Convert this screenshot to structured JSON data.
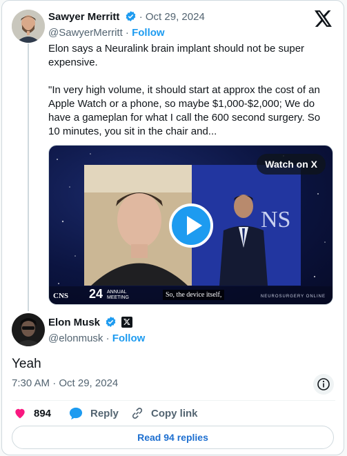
{
  "original_tweet": {
    "author_name": "Sawyer Merritt",
    "separator": "·",
    "date": "Oct 29, 2024",
    "handle": "@SawyerMerritt",
    "handle_sep": "·",
    "follow_label": "Follow",
    "text": "Elon says a Neuralink brain implant should not be super expensive.\n\n\"In very high volume, it should start at approx the cost of an Apple Watch or a phone, so maybe $1,000-$2,000; We do have a gameplan for what I call the 600 second surgery. So 10 minutes, you sit in the chair and...",
    "media": {
      "watch_label": "Watch on X",
      "overlay_logo": "CNS",
      "overlay_year": "24",
      "overlay_event_1": "ANNUAL",
      "overlay_event_2": "MEETING",
      "subtitle": "So, the device itself,",
      "overlay_right": "NEUROSURGERY ONLINE"
    }
  },
  "reply_tweet": {
    "author_name": "Elon Musk",
    "handle": "@elonmusk",
    "handle_sep": "·",
    "follow_label": "Follow",
    "text": "Yeah",
    "timestamp": "7:30 AM · Oct 29, 2024"
  },
  "actions": {
    "likes": "894",
    "reply_label": "Reply",
    "copy_link_label": "Copy link",
    "read_replies_label": "Read 94 replies"
  },
  "colors": {
    "accent": "#1d9bf0",
    "like": "#f91880",
    "text": "#0f1419",
    "muted": "#536471"
  }
}
